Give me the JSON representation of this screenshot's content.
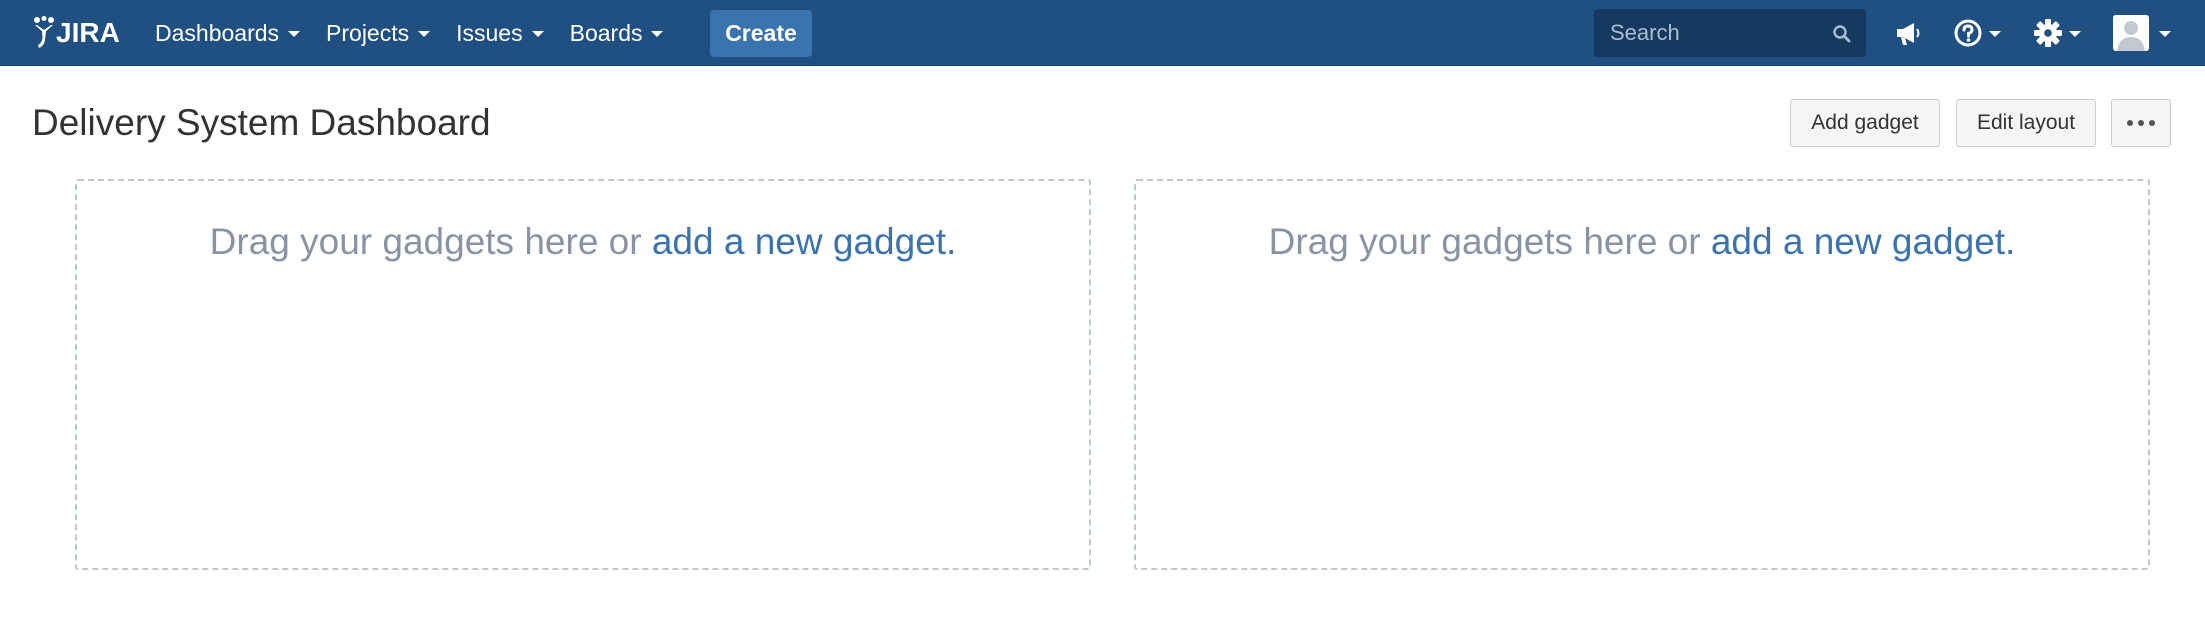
{
  "header": {
    "logo_text": "JIRA",
    "nav": [
      {
        "label": "Dashboards"
      },
      {
        "label": "Projects"
      },
      {
        "label": "Issues"
      },
      {
        "label": "Boards"
      }
    ],
    "create_label": "Create",
    "search": {
      "placeholder": "Search",
      "value": ""
    },
    "icons": [
      "notifications-megaphone-icon",
      "help-icon",
      "settings-gear-icon",
      "user-avatar"
    ]
  },
  "page": {
    "title": "Delivery System Dashboard",
    "buttons": {
      "add_gadget": "Add gadget",
      "edit_layout": "Edit layout",
      "more": "more-options-icon"
    }
  },
  "columns": [
    {
      "text": "Drag your gadgets here or ",
      "link": "add a new gadget."
    },
    {
      "text": "Drag your gadgets here or ",
      "link": "add a new gadget."
    }
  ],
  "colors": {
    "header_bg": "#205081",
    "create_bg": "#3b73af",
    "search_bg": "#163a5f",
    "link": "#3b73af",
    "muted_text": "#8993a4",
    "dashed_border": "#c1c7d0"
  }
}
